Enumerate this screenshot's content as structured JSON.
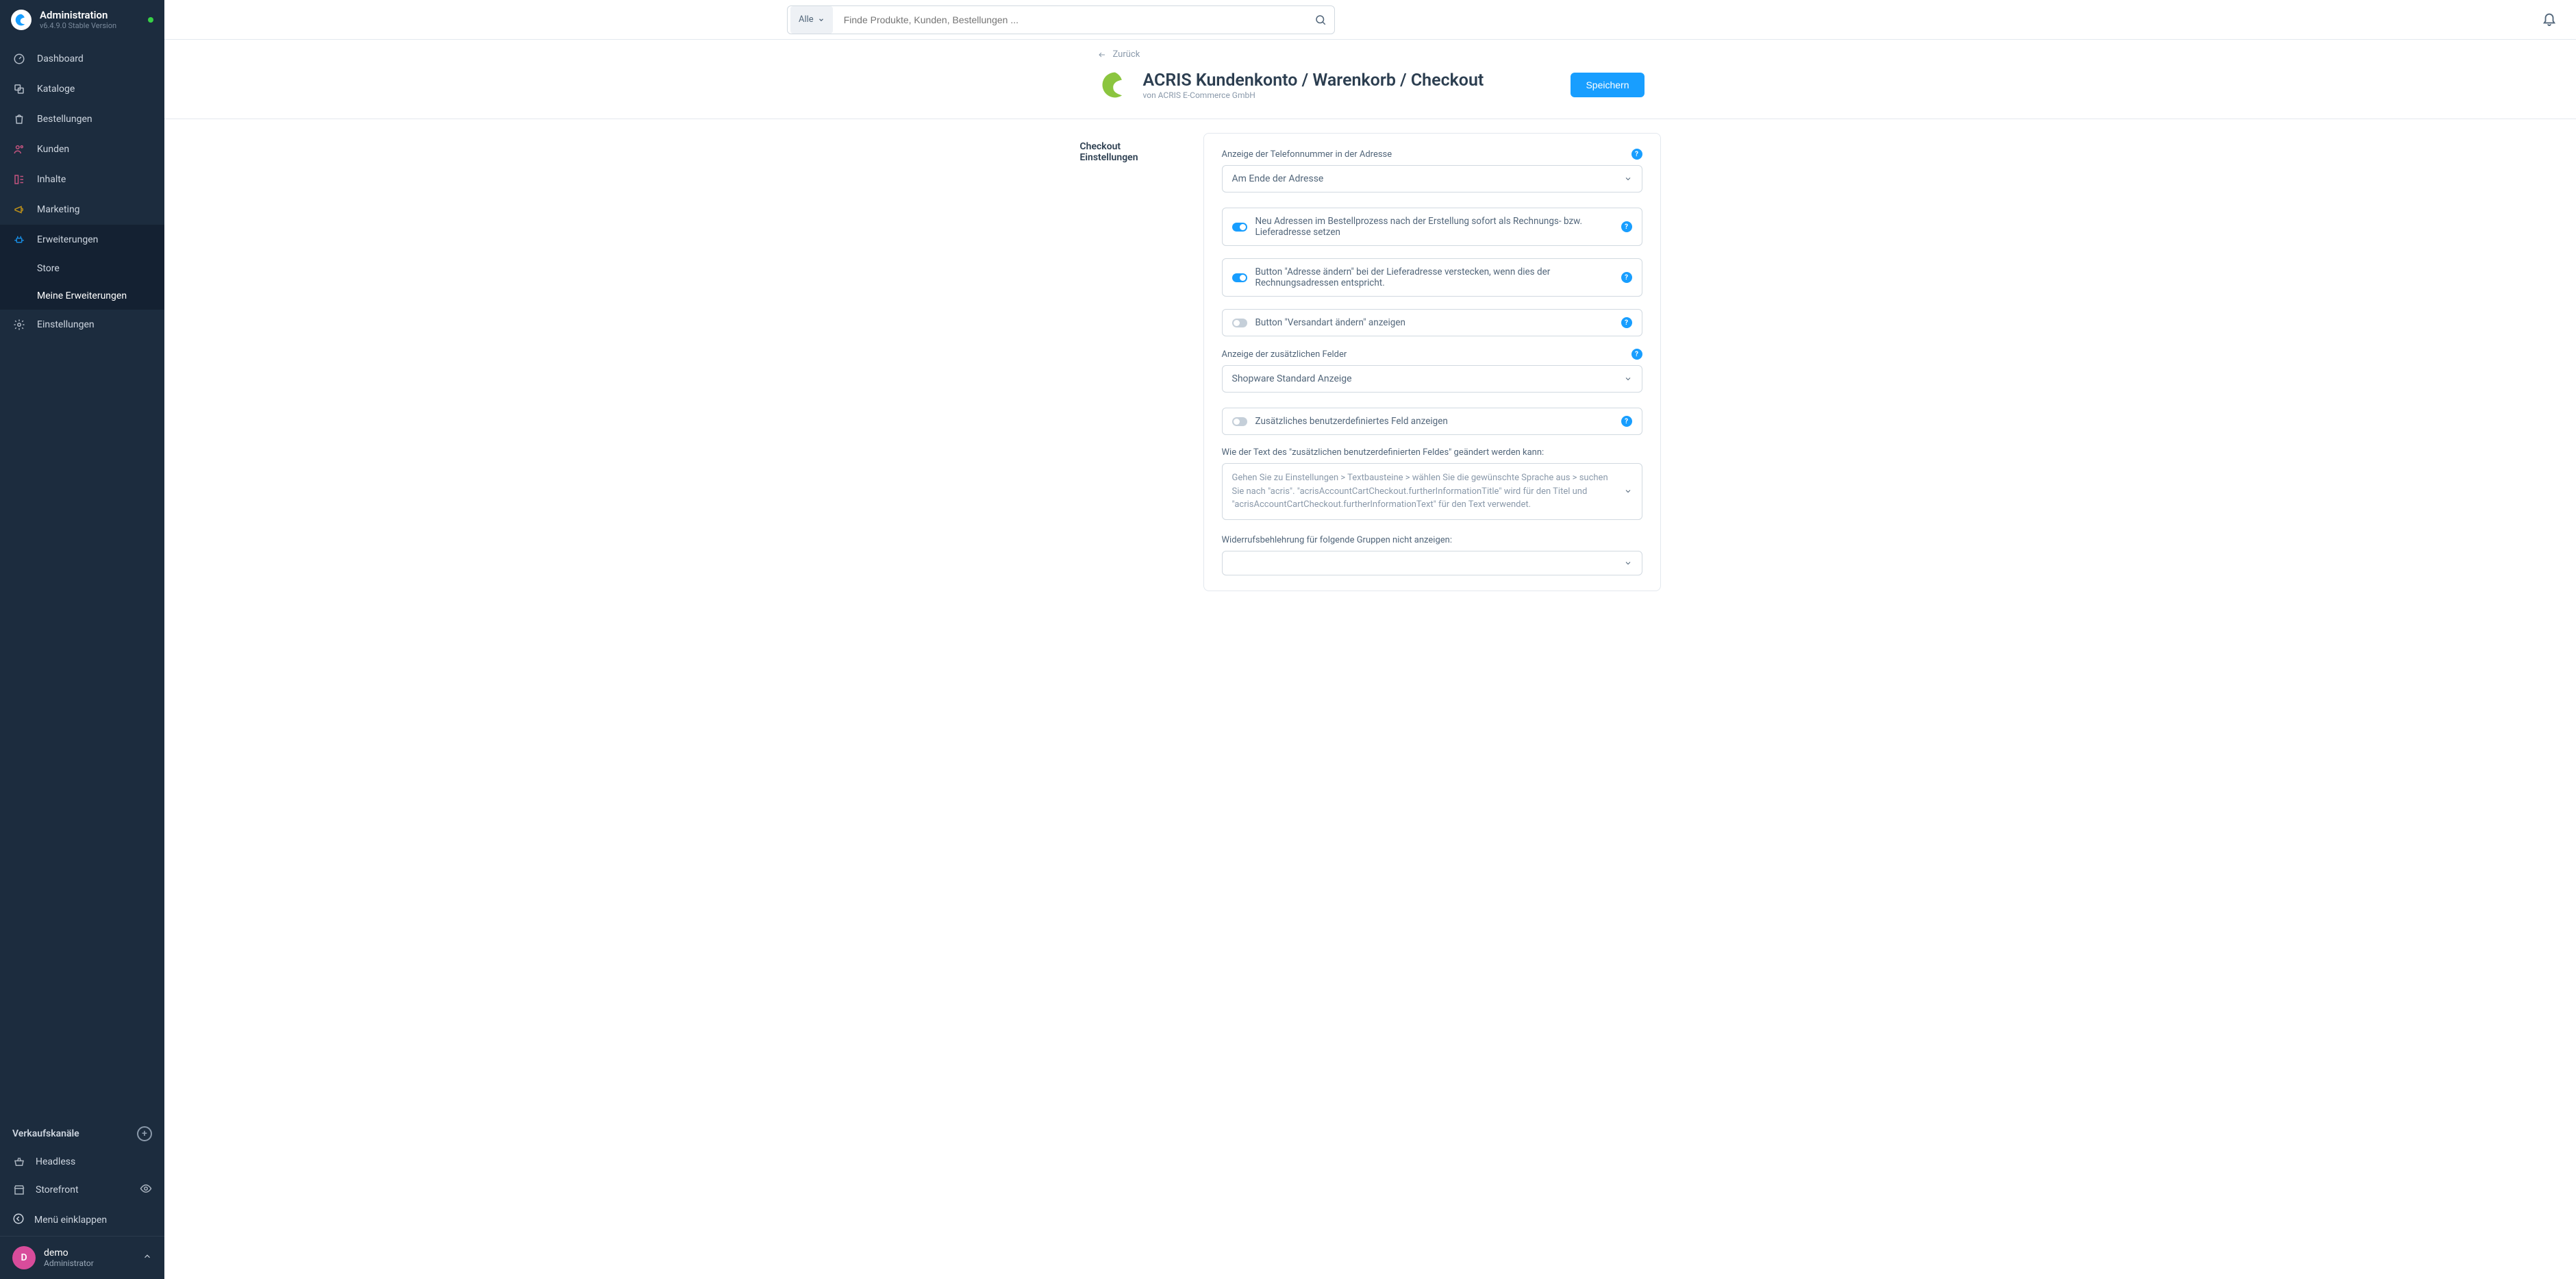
{
  "app": {
    "title": "Administration",
    "version": "v6.4.9.0 Stable Version"
  },
  "search": {
    "scope": "Alle",
    "placeholder": "Finde Produkte, Kunden, Bestellungen ..."
  },
  "nav": {
    "dashboard": "Dashboard",
    "catalogues": "Kataloge",
    "orders": "Bestellungen",
    "customers": "Kunden",
    "content": "Inhalte",
    "marketing": "Marketing",
    "extensions": "Erweiterungen",
    "store": "Store",
    "my_extensions": "Meine Erweiterungen",
    "settings": "Einstellungen"
  },
  "channels": {
    "head": "Verkaufskanäle",
    "headless": "Headless",
    "storefront": "Storefront"
  },
  "collapse": "Menü einklappen",
  "user": {
    "initial": "D",
    "name": "demo",
    "role": "Administrator"
  },
  "back": "Zurück",
  "plugin": {
    "title": "ACRIS Kundenkonto / Warenkorb / Checkout",
    "vendor": "von ACRIS E-Commerce GmbH"
  },
  "save": "Speichern",
  "section": "Checkout Einstellungen",
  "fields": {
    "phone_display": {
      "label": "Anzeige der Telefonnummer in der Adresse",
      "value": "Am Ende der Adresse"
    },
    "sw_new_address": "Neu Adressen im Bestellprozess nach der Erstellung sofort als Rechnungs- bzw. Lieferadresse setzen",
    "sw_hide_change": "Button \"Adresse ändern\" bei der Lieferadresse verstecken, wenn dies der Rechnungsadressen entspricht.",
    "sw_show_shipping": "Button \"Versandart ändern\" anzeigen",
    "extra_fields": {
      "label": "Anzeige der zusätzlichen Felder",
      "value": "Shopware Standard Anzeige"
    },
    "sw_custom_field": "Zusätzliches benutzerdefiniertes Feld anzeigen",
    "custom_howto_label": "Wie der Text des \"zusätzlichen benutzerdefinierten Feldes\" geändert werden kann:",
    "custom_howto_text": "Gehen Sie zu Einstellungen > Textbausteine > wählen Sie die gewünschte Sprache aus > suchen Sie nach \"acris\". \"acrisAccountCartCheckout.furtherInformationTitle\" wird für den Titel und \"acrisAccountCartCheckout.furtherInformationText\" für den Text verwendet.",
    "revocation_label": "Widerrufsbehlehrung für folgende Gruppen nicht anzeigen:"
  }
}
